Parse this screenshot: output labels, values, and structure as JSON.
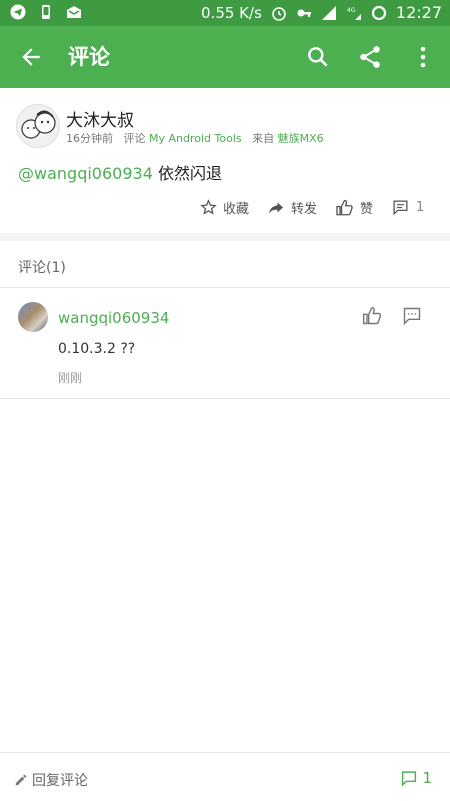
{
  "status_bar": {
    "network_speed": "0.55 K/s",
    "time": "12:27",
    "icons": [
      "telegram-icon",
      "phone-icon",
      "mail-icon",
      "alarm-icon",
      "key-icon",
      "signal-icon",
      "4g-icon",
      "loading-icon"
    ]
  },
  "app_bar": {
    "title": "评论",
    "icons": [
      "back-arrow-icon",
      "search-icon",
      "share-icon",
      "more-vert-icon"
    ],
    "color": "#4caf50"
  },
  "post": {
    "author": "大沐大叔",
    "time_ago": "16分钟前",
    "comment_prefix": "评论",
    "app_link": "My Android Tools",
    "source_prefix": "来自",
    "device": "魅族MX6",
    "mention": "@wangqi060934",
    "text": " 依然闪退",
    "actions": {
      "favorite": "收藏",
      "forward": "转发",
      "like": "赞",
      "comment_count": "1"
    }
  },
  "comments_section": {
    "header": "评论(1)",
    "items": [
      {
        "user": "wangqi060934",
        "text": "0.10.3.2 ??",
        "time": "刚刚"
      }
    ]
  },
  "bottom_bar": {
    "reply_label": "回复评论",
    "comment_count": "1"
  }
}
